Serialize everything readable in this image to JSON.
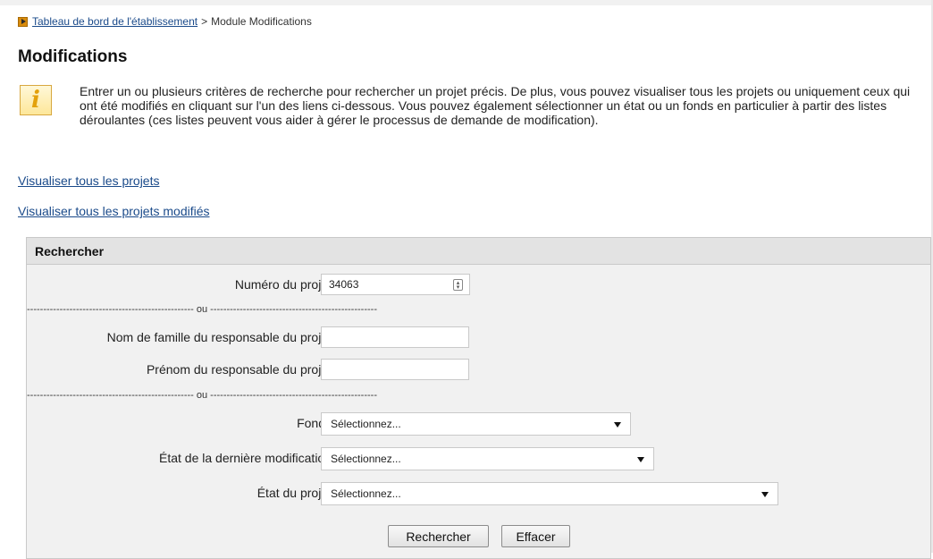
{
  "breadcrumb": {
    "link": "Tableau de bord de l'établissement",
    "separator": ">",
    "current": "Module Modifications"
  },
  "page": {
    "title": "Modifications",
    "info_text": "Entrer un ou plusieurs critères de recherche pour rechercher un projet précis. De plus, vous pouvez visualiser tous les projets ou uniquement ceux qui ont été modifiés en cliquant sur l'un des liens ci-dessous. Vous pouvez également sélectionner un état ou un fonds en particulier à partir des listes déroulantes (ces listes peuvent vous aider à gérer le processus de demande de modification)."
  },
  "links": {
    "all_projects": "Visualiser tous les projets",
    "modified_projects": "Visualiser tous les projets modifiés"
  },
  "search": {
    "header": "Rechercher",
    "project_number_label": "Numéro du projet",
    "project_number_value": "34063",
    "separator_1": "--------------------------------------------------- ou ---------------------------------------------------",
    "lastname_label": "Nom de famille du responsable du projet",
    "lastname_value": "",
    "firstname_label": "Prénom du responsable du projet",
    "firstname_value": "",
    "separator_2": "--------------------------------------------------- ou ---------------------------------------------------",
    "fund_label": "Fonds",
    "fund_value": "Sélectionnez...",
    "last_mod_state_label": "État de la dernière modification",
    "last_mod_state_value": "Sélectionnez...",
    "project_state_label": "État du projet",
    "project_state_value": "Sélectionnez...",
    "search_button": "Rechercher",
    "clear_button": "Effacer"
  }
}
